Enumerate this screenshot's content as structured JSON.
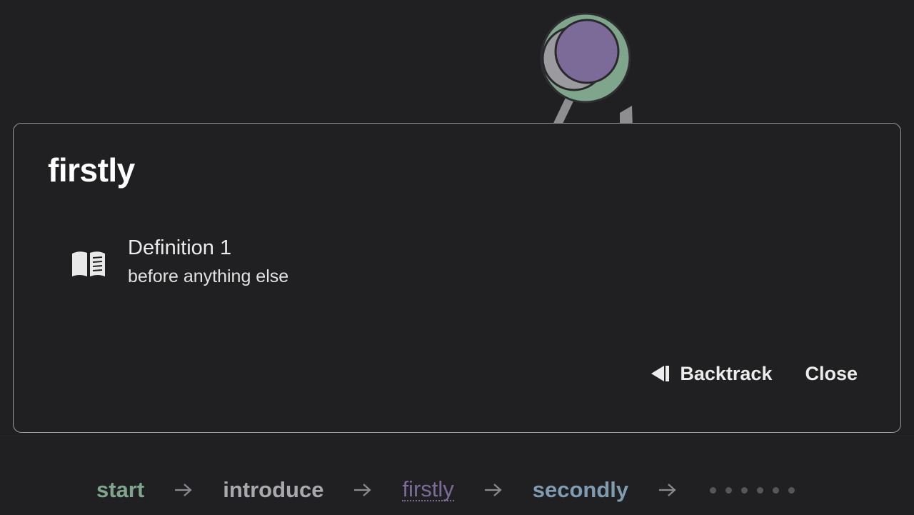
{
  "modal": {
    "title": "firstly",
    "definition": {
      "heading": "Definition 1",
      "text": "before anything else",
      "icon": "open-book-icon"
    },
    "actions": {
      "backtrack_label": "Backtrack",
      "backtrack_icon": "step-back-icon",
      "close_label": "Close"
    }
  },
  "breadcrumb": {
    "items": [
      {
        "label": "start",
        "color": "#7fa68c"
      },
      {
        "label": "introduce",
        "color": "#a9a9ad"
      },
      {
        "label": "firstly",
        "color": "#7c6b99"
      },
      {
        "label": "secondly",
        "color": "#7f9bb0"
      }
    ],
    "separator_icon": "arrow-right-icon",
    "pending_dots": 6
  },
  "colors": {
    "background": "#202022",
    "modal_border": "#9a9a9a",
    "pin_head_green": "#7fa68c",
    "pin_head_purple": "#7c6b99",
    "pin_head_grey": "#9b9b9f"
  }
}
